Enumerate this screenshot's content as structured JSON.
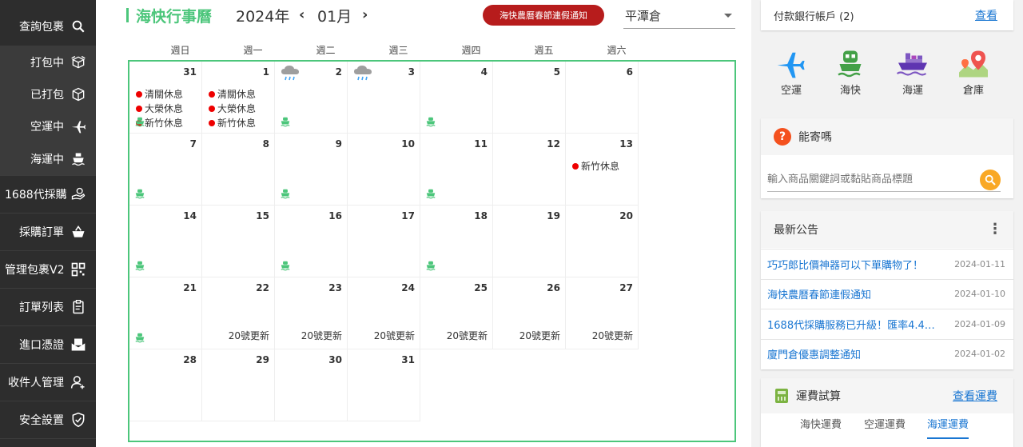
{
  "sidebar": {
    "items": [
      {
        "label": "查詢包裹",
        "icon": "search-icon"
      },
      {
        "label": "打包中",
        "icon": "package-open-icon"
      },
      {
        "label": "已打包",
        "icon": "package-icon"
      },
      {
        "label": "空運中",
        "icon": "airplane-icon"
      },
      {
        "label": "海運中",
        "icon": "ship-icon"
      },
      {
        "label": "1688代採購",
        "icon": "hand-coin-icon"
      },
      {
        "label": "採購訂單",
        "icon": "basket-icon"
      },
      {
        "label": "管理包裹V2",
        "icon": "qr-grid-icon"
      },
      {
        "label": "訂單列表",
        "icon": "clipboard-icon"
      },
      {
        "label": "進口憑證",
        "icon": "mail-document-icon"
      },
      {
        "label": "收件人管理",
        "icon": "user-add-icon"
      },
      {
        "label": "安全設置",
        "icon": "shield-check-icon"
      }
    ]
  },
  "calendar": {
    "title": "海快行事曆",
    "year": "2024年",
    "prev": "‹",
    "month": "01月",
    "next": "›",
    "notice": "海快農曆春節連假通知",
    "warehouse": "平潭倉",
    "weekdays": [
      "週日",
      "週一",
      "週二",
      "週三",
      "週四",
      "週五",
      "週六"
    ],
    "days": [
      {
        "n": "31",
        "events": [
          "清關休息",
          "大榮休息",
          "新竹休息"
        ],
        "ship": true
      },
      {
        "n": "1",
        "events": [
          "清關休息",
          "大榮休息",
          "新竹休息"
        ]
      },
      {
        "n": "2",
        "weather": true,
        "ship": true
      },
      {
        "n": "3",
        "weather": true
      },
      {
        "n": "4",
        "ship": true
      },
      {
        "n": "5"
      },
      {
        "n": "6"
      },
      {
        "n": "7",
        "ship": true
      },
      {
        "n": "8"
      },
      {
        "n": "9",
        "ship": true
      },
      {
        "n": "10"
      },
      {
        "n": "11",
        "ship": true
      },
      {
        "n": "12"
      },
      {
        "n": "13",
        "events": [
          "新竹休息"
        ]
      },
      {
        "n": "14",
        "ship": true
      },
      {
        "n": "15"
      },
      {
        "n": "16",
        "ship": true
      },
      {
        "n": "17"
      },
      {
        "n": "18",
        "ship": true
      },
      {
        "n": "19"
      },
      {
        "n": "20"
      },
      {
        "n": "21",
        "ship": true
      },
      {
        "n": "22",
        "update": "20號更新"
      },
      {
        "n": "23",
        "update": "20號更新"
      },
      {
        "n": "24",
        "update": "20號更新"
      },
      {
        "n": "25",
        "update": "20號更新"
      },
      {
        "n": "26",
        "update": "20號更新"
      },
      {
        "n": "27",
        "update": "20號更新"
      },
      {
        "n": "28"
      },
      {
        "n": "29"
      },
      {
        "n": "30"
      },
      {
        "n": "31"
      }
    ]
  },
  "right": {
    "bank": {
      "label": "付款銀行帳戶 (2)",
      "link": "查看"
    },
    "transport": [
      {
        "label": "空運",
        "icon": "airplane-icon",
        "color": "#2196f3"
      },
      {
        "label": "海快",
        "icon": "ferry-icon",
        "color": "#43a047"
      },
      {
        "label": "海運",
        "icon": "cargo-ship-icon",
        "color": "#7e57c2"
      },
      {
        "label": "倉庫",
        "icon": "map-pin-icon",
        "color": "#ef5350"
      }
    ],
    "cansend": {
      "title": "能寄嗎",
      "placeholder": "輸入商品關鍵詞或黏貼商品標題"
    },
    "announcements": {
      "title": "最新公告",
      "items": [
        {
          "title": "巧巧郎比價神器可以下單購物了！",
          "date": "2024-01-11"
        },
        {
          "title": "海快農曆春節連假通知",
          "date": "2024-01-10"
        },
        {
          "title": "1688代採購服務已升級！匯率4.4…",
          "date": "2024-01-09"
        },
        {
          "title": "廈門倉優惠調整通知",
          "date": "2024-01-02"
        }
      ]
    },
    "fee": {
      "title": "運費試算",
      "link": "查看運費",
      "tabs": [
        "海快運費",
        "空運運費",
        "海運運費"
      ]
    }
  },
  "colors": {
    "accent": "#4cc67b",
    "notice": "#b71c1c",
    "link": "#1976d2",
    "sidebar": "#2d2d2d"
  }
}
